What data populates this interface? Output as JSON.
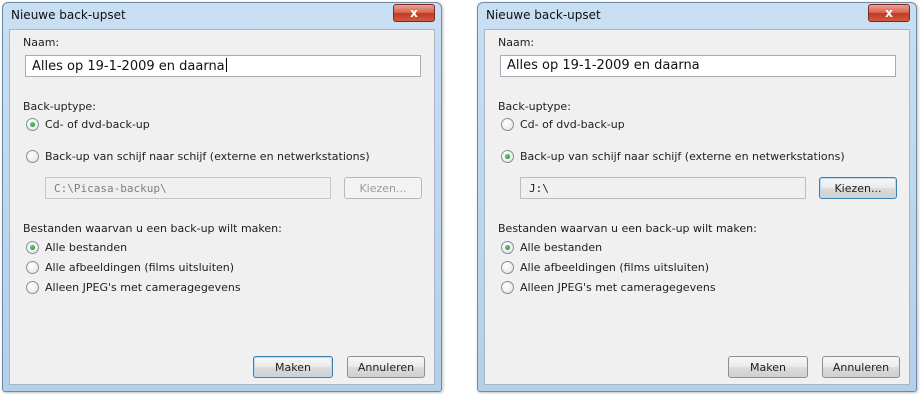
{
  "dialog1": {
    "title": "Nieuwe back-upset",
    "name_label": "Naam:",
    "name_value": "Alles op 19-1-2009 en daarna",
    "backup_type_label": "Back-uptype:",
    "option_cd": "Cd- of dvd-back-up",
    "option_disk": "Back-up van schijf naar schijf (externe en netwerkstations)",
    "path_value": "C:\\Picasa-backup\\",
    "choose_label": "Kiezen...",
    "files_label": "Bestanden waarvan u een back-up wilt maken:",
    "option_all": "Alle bestanden",
    "option_images": "Alle afbeeldingen (films uitsluiten)",
    "option_jpeg": "Alleen JPEG's met cameragegevens",
    "make_label": "Maken",
    "cancel_label": "Annuleren"
  },
  "dialog2": {
    "title": "Nieuwe back-upset",
    "name_label": "Naam:",
    "name_value": "Alles op 19-1-2009 en daarna",
    "backup_type_label": "Back-uptype:",
    "option_cd": "Cd- of dvd-back-up",
    "option_disk": "Back-up van schijf naar schijf (externe en netwerkstations)",
    "path_value": "J:\\",
    "choose_label": "Kiezen...",
    "files_label": "Bestanden waarvan u een back-up wilt maken:",
    "option_all": "Alle bestanden",
    "option_images": "Alle afbeeldingen (films uitsluiten)",
    "option_jpeg": "Alleen JPEG's met cameragegevens",
    "make_label": "Maken",
    "cancel_label": "Annuleren"
  },
  "close_glyph": "x"
}
